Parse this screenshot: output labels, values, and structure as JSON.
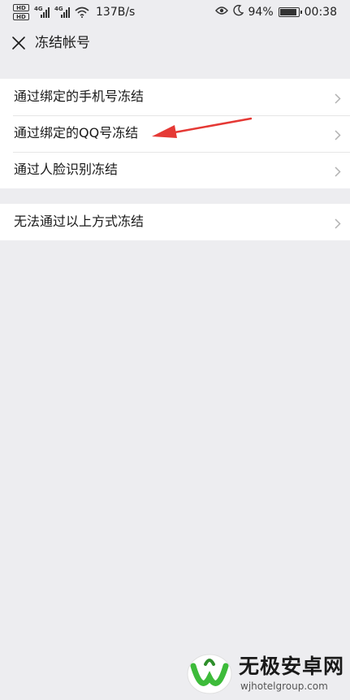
{
  "status_bar": {
    "hd_labels": [
      "HD",
      "HD"
    ],
    "network_tags": [
      "4G",
      "4G"
    ],
    "net_speed": "137B/s",
    "battery_percent": "94%",
    "battery_level": 0.94,
    "time": "00:38",
    "icons": [
      "eye-icon",
      "moon-icon",
      "battery-icon",
      "wifi-icon",
      "signal-icon"
    ]
  },
  "header": {
    "title": "冻结帐号",
    "close_icon": "close-icon"
  },
  "freeze_methods": [
    {
      "label": "通过绑定的手机号冻结"
    },
    {
      "label": "通过绑定的QQ号冻结"
    },
    {
      "label": "通过人脸识别冻结"
    }
  ],
  "other_methods": [
    {
      "label": "无法通过以上方式冻结"
    }
  ],
  "annotation": {
    "type": "red-arrow",
    "color": "#e53935",
    "points_to": "通过绑定的QQ号冻结"
  },
  "watermark": {
    "title": "无极安卓网",
    "url": "wjhotelgroup.com",
    "logo_color": "#3dbb3a"
  }
}
